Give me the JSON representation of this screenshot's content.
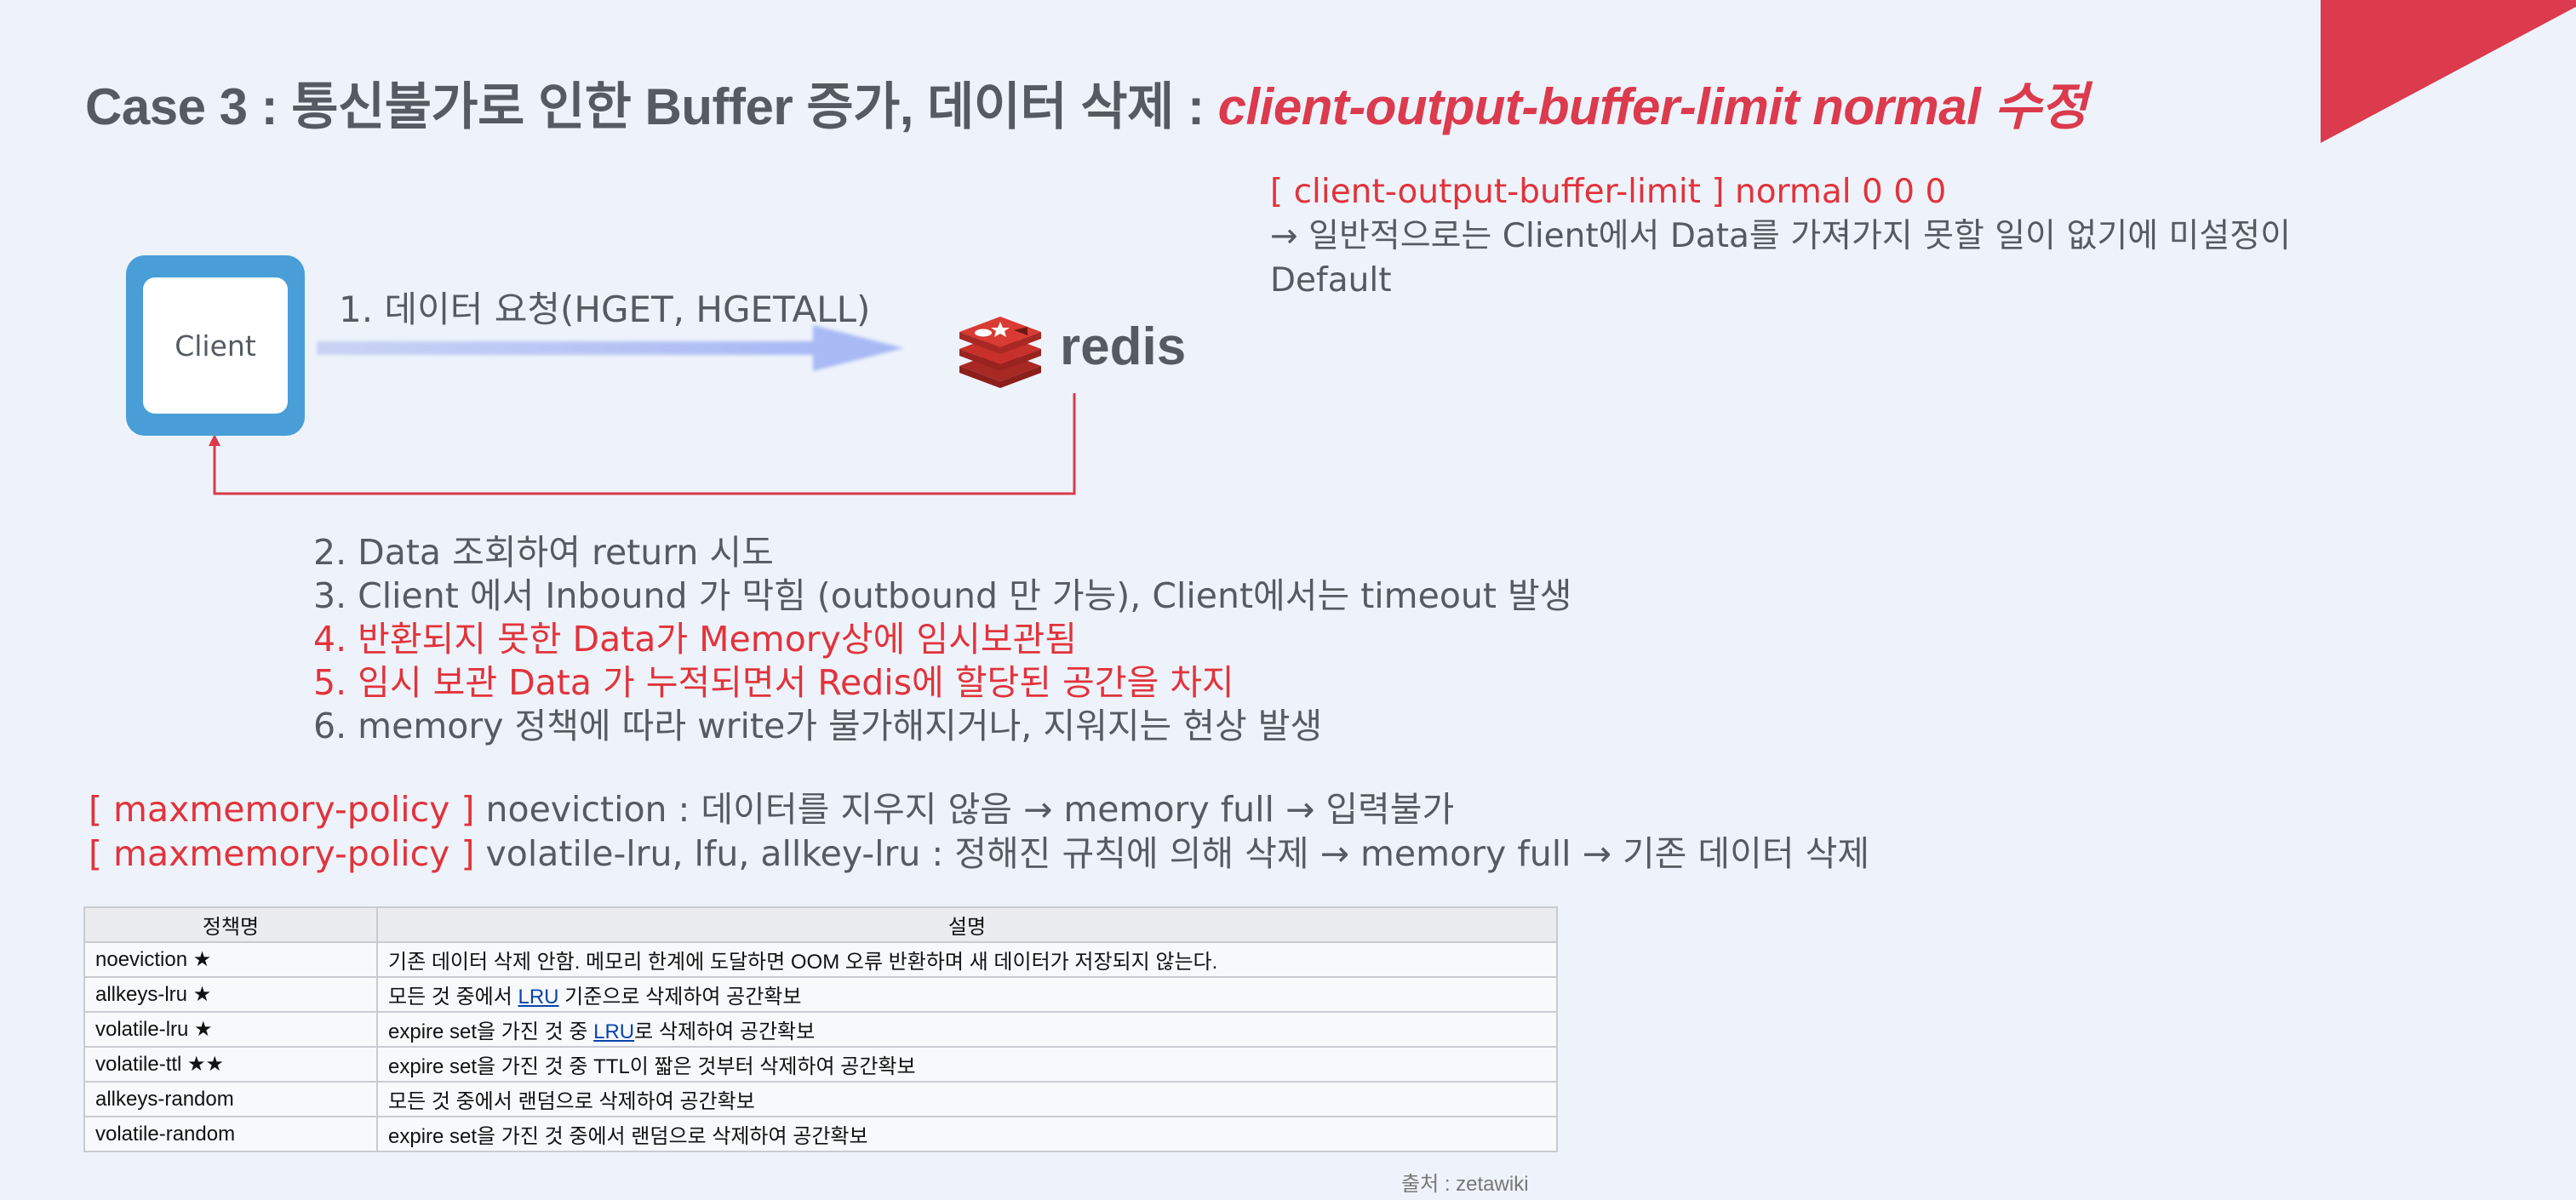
{
  "title": {
    "main": "Case 3 : 통신불가로 인한 Buffer 증가, 데이터 삭제 : ",
    "accent": "client-output-buffer-limit normal 수정"
  },
  "config_note": {
    "key": "[ client-output-buffer-limit  ] normal 0 0 0",
    "line2": " → 일반적으로는 Client에서 Data를 가져가지 못할 일이 없기에 미설정이",
    "line3": "Default"
  },
  "diagram": {
    "client_label": "Client",
    "request_label": "1. 데이터 요청(HGET, HGETALL)",
    "redis_wordmark": "redis"
  },
  "steps": [
    {
      "text": "2. Data 조회하여 return 시도",
      "highlight": false
    },
    {
      "text": "3. Client 에서 Inbound 가 막힘 (outbound 만 가능), Client에서는 timeout 발생",
      "highlight": false
    },
    {
      "text": "4. 반환되지 못한 Data가 Memory상에 임시보관됨",
      "highlight": true
    },
    {
      "text": "5. 임시 보관 Data 가 누적되면서 Redis에 할당된 공간을 차지",
      "highlight": true
    },
    {
      "text": "6. memory 정책에 따라 write가 불가해지거나, 지워지는 현상 발생",
      "highlight": false
    }
  ],
  "policies": [
    {
      "key": "[ maxmemory-policy ]",
      "text": " noeviction : 데이터를 지우지 않음 → memory full → 입력불가"
    },
    {
      "key": "[ maxmemory-policy ]",
      "text": " volatile-lru, lfu, allkey-lru : 정해진 규칙에 의해 삭제 → memory full → 기존 데이터 삭제"
    }
  ],
  "table": {
    "headers": [
      "정책명",
      "설명"
    ],
    "rows": [
      {
        "name": "noeviction ★",
        "pre": "기존 데이터 삭제 안함. 메모리 한계에 도달하면 OOM 오류 반환하며 새 데이터가 저장되지 않는다.",
        "link": "",
        "post": ""
      },
      {
        "name": "allkeys-lru ★",
        "pre": "모든 것 중에서 ",
        "link": "LRU",
        "post": " 기준으로 삭제하여 공간확보"
      },
      {
        "name": "volatile-lru ★",
        "pre": "expire set을 가진 것 중 ",
        "link": "LRU",
        "post": "로 삭제하여 공간확보"
      },
      {
        "name": "volatile-ttl ★★",
        "pre": "expire set을 가진 것 중 TTL이 짧은 것부터 삭제하여 공간확보",
        "link": "",
        "post": ""
      },
      {
        "name": "allkeys-random",
        "pre": "모든 것 중에서 랜덤으로 삭제하여 공간확보",
        "link": "",
        "post": ""
      },
      {
        "name": "volatile-random",
        "pre": "expire set을 가진 것 중에서 랜덤으로 삭제하여 공간확보",
        "link": "",
        "post": ""
      }
    ]
  },
  "source": "출처 : zetawiki",
  "colors": {
    "accent": "#dc3a4d",
    "highlight": "#e2333b",
    "client_blue": "#4a9ed8",
    "redis_red": "#c8302b",
    "background": "#eef3fb"
  }
}
